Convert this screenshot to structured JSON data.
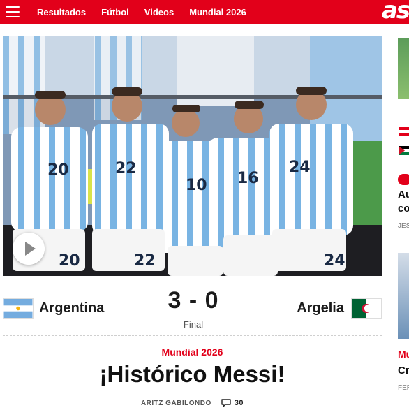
{
  "header": {
    "nav": [
      "Resultados",
      "Fútbol",
      "Videos",
      "Mundial 2026"
    ],
    "logo": "as",
    "brand_color": "#e2001a"
  },
  "hero": {
    "jersey_numbers": [
      "20",
      "22",
      "10",
      "16",
      "24"
    ],
    "shorts_numbers": [
      "20",
      "22",
      "24"
    ],
    "icon": "play-icon"
  },
  "match": {
    "home_team": "Argentina",
    "away_team": "Argelia",
    "score": "3 - 0",
    "status": "Final"
  },
  "article": {
    "kicker": "Mundial 2026",
    "headline": "¡Histórico Messi!",
    "author": "ARITZ GABILONDO",
    "comments_count": "30"
  },
  "sidebar": {
    "teaser1_title": "Au",
    "teaser1_title2": "co",
    "teaser1_meta": "JES",
    "teaser2_kicker": "Mu",
    "teaser2_title": "Cr",
    "teaser2_meta": "FER"
  }
}
